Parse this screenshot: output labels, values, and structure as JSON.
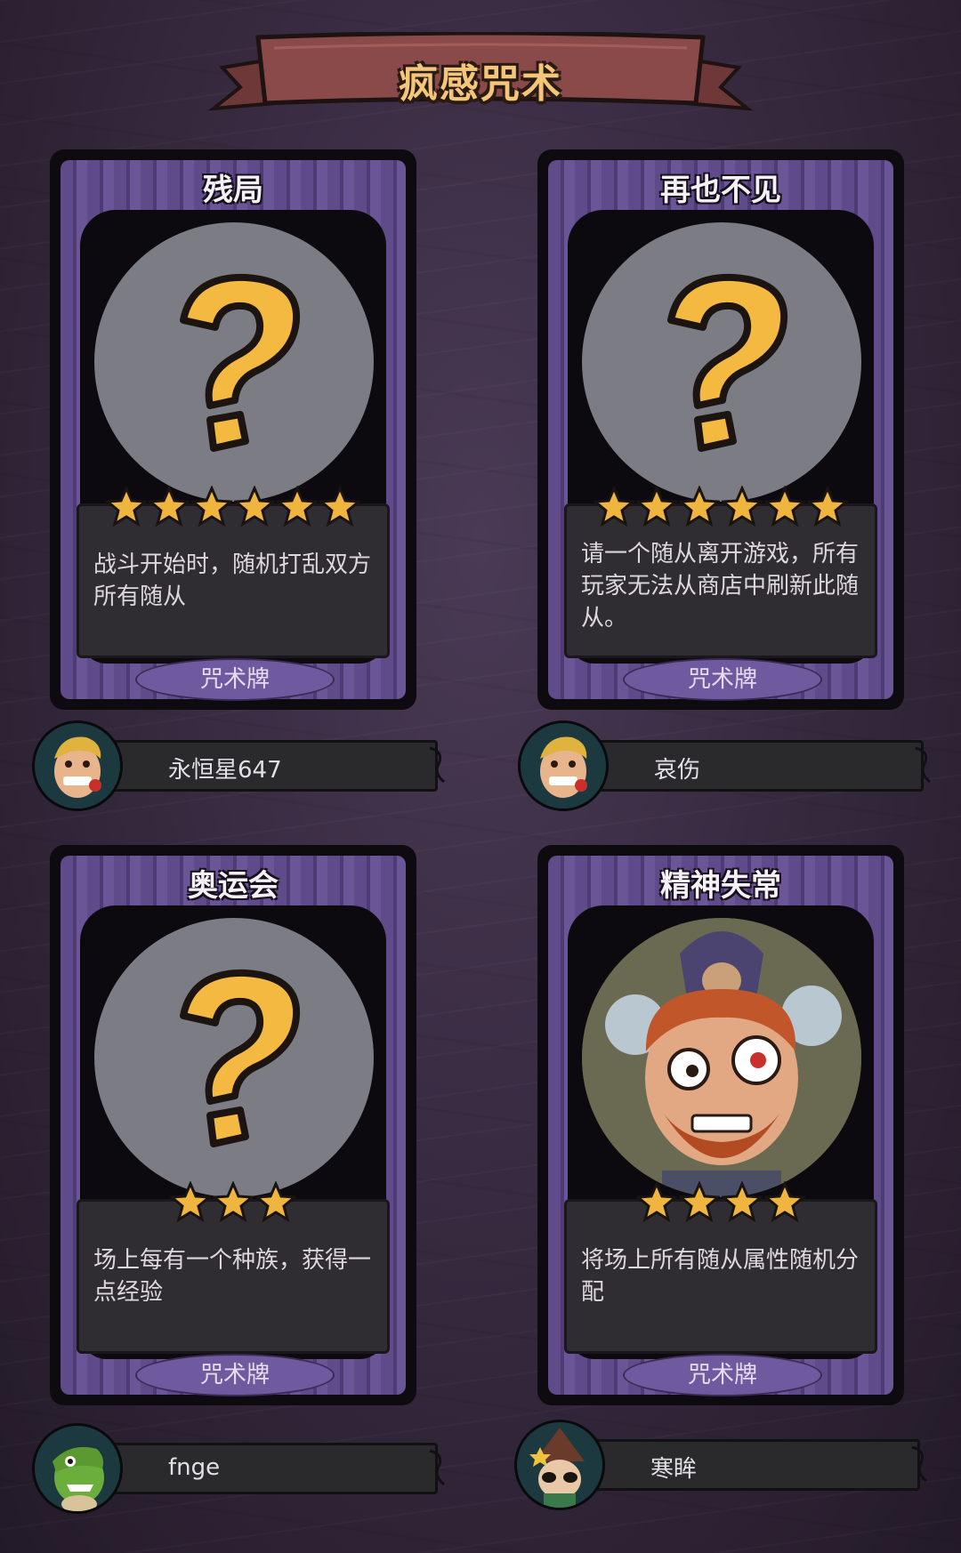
{
  "banner": {
    "title": "疯感咒术"
  },
  "cards": [
    {
      "title": "残局",
      "stars": 6,
      "description": "战斗开始时，随机打乱双方所有随从",
      "type_label": "咒术牌",
      "art": "question-mark-icon",
      "author": {
        "name": "永恒星647",
        "avatar": "rose-man-avatar"
      }
    },
    {
      "title": "再也不见",
      "stars": 6,
      "description": "请一个随从离开游戏，所有玩家无法从商店中刷新此随从。",
      "type_label": "咒术牌",
      "art": "question-mark-icon",
      "author": {
        "name": "哀伤",
        "avatar": "rose-man-avatar"
      }
    },
    {
      "title": "奥运会",
      "stars": 3,
      "description": "场上每有一个种族，获得一点经验",
      "type_label": "咒术牌",
      "art": "question-mark-icon",
      "author": {
        "name": "fnge",
        "avatar": "green-dinosaur-avatar"
      }
    },
    {
      "title": "精神失常",
      "stars": 4,
      "description": "将场上所有随从属性随机分配",
      "type_label": "咒术牌",
      "art": "crazed-bearded-man-illustration",
      "author": {
        "name": "寒眸",
        "avatar": "witch-hat-avatar"
      }
    }
  ],
  "colors": {
    "card_purple": "#5f4a8a",
    "star_gold": "#f0b53e",
    "banner_red": "#8a4a4a",
    "title_gold": "#f3c679"
  }
}
